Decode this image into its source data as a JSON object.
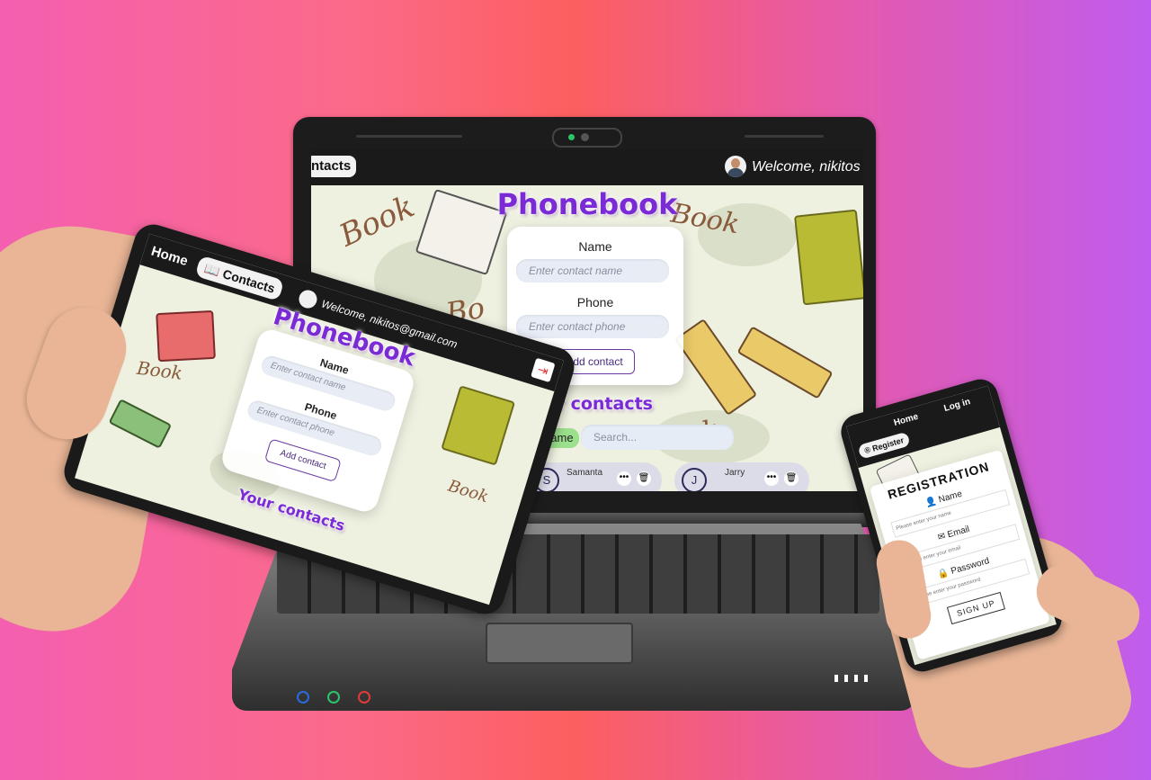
{
  "laptop": {
    "header": {
      "tab_contacts": "ntacts",
      "welcome": "Welcome, nikitos"
    },
    "brand": "Phonebook",
    "form": {
      "name_label": "Name",
      "name_placeholder": "Enter contact name",
      "phone_label": "Phone",
      "phone_placeholder": "Enter contact phone",
      "add_button": "Add contact"
    },
    "contacts_heading": "Your contacts",
    "filter": {
      "label": "ts by name",
      "placeholder": "Search..."
    },
    "contacts": [
      {
        "initial": "S",
        "name": "Samanta"
      },
      {
        "initial": "J",
        "name": "Jarry"
      }
    ]
  },
  "tablet": {
    "nav": {
      "home": "Home",
      "contacts": "Contacts"
    },
    "welcome": "Welcome, nikitos@gmail.com",
    "brand": "Phonebook",
    "form": {
      "name_label": "Name",
      "name_placeholder": "Enter contact name",
      "phone_label": "Phone",
      "phone_placeholder": "Enter contact phone",
      "add_button": "Add contact"
    },
    "contacts_heading": "Your contacts"
  },
  "phone": {
    "nav": {
      "home": "Home",
      "login": "Log in",
      "register": "Register"
    },
    "title": "REGISTRATION",
    "fields": {
      "name_label": "Name",
      "name_placeholder": "Please enter your name",
      "email_label": "Email",
      "email_placeholder": "Please enter your email",
      "password_label": "Password",
      "password_placeholder": "Please enter your password"
    },
    "signup_button": "SIGN UP"
  },
  "colors": {
    "brand_purple": "#7a2bd6",
    "bg_left": "#f45fb0",
    "bg_right": "#c05cee"
  }
}
